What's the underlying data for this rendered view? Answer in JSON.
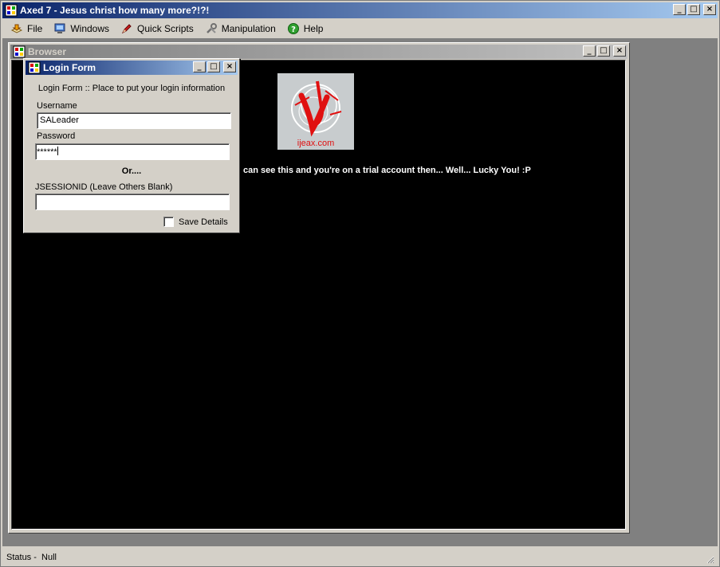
{
  "app": {
    "title": "Axed 7 - Jesus christ how many more?!?!"
  },
  "window_buttons": {
    "minimize": "_",
    "maximize": "□",
    "close": "×"
  },
  "menu": [
    {
      "label": "File",
      "icon": "file-icon"
    },
    {
      "label": "Windows",
      "icon": "windows-icon"
    },
    {
      "label": "Quick Scripts",
      "icon": "quick-scripts-icon"
    },
    {
      "label": "Manipulation",
      "icon": "manipulation-icon"
    },
    {
      "label": "Help",
      "icon": "help-icon"
    }
  ],
  "browser": {
    "title": "Browser",
    "logo_text": "ijeax.com",
    "message": "can see this and you're on a trial account then... Well... Lucky You! :P"
  },
  "login": {
    "title": "Login Form",
    "description": "Login Form :: Place to put your login information",
    "username_label": "Username",
    "username_value": "SALeader",
    "password_label": "Password",
    "password_value": "******",
    "or_text": "Or....",
    "session_label": "JSESSIONID (Leave Others Blank)",
    "session_value": "",
    "save_label": "Save Details",
    "save_checked": false
  },
  "status": {
    "text": "Status -  Null"
  },
  "colors": {
    "active_title_start": "#0a246a",
    "active_title_end": "#a6caf0",
    "inactive_title_start": "#808080",
    "inactive_title_end": "#c0c0c0",
    "chrome": "#d4d0c8",
    "mdi_background": "#808080",
    "browser_background": "#000000",
    "logo_red": "#e01010"
  }
}
